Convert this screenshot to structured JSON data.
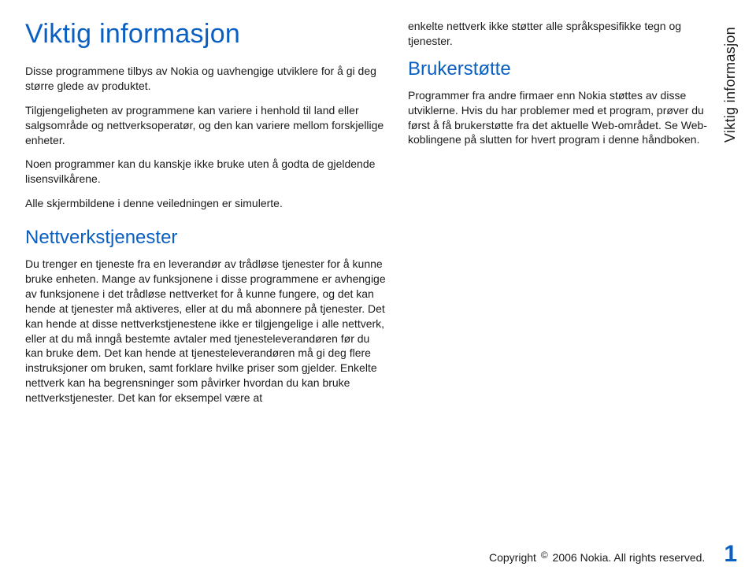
{
  "title": "Viktig informasjon",
  "sidebar_label": "Viktig informasjon",
  "left": {
    "p1": "Disse programmene tilbys av Nokia og uavhengige utviklere for å gi deg større glede av produktet.",
    "p2": "Tilgjengeligheten av programmene kan variere i henhold til land eller salgsområde og nettverksoperatør, og den kan variere mellom forskjellige enheter.",
    "p3": "Noen programmer kan du kanskje ikke bruke uten å godta de gjeldende lisensvilkårene.",
    "p4": "Alle skjermbildene i denne veiledningen er simulerte.",
    "h2": "Nettverkstjenester",
    "p5": "Du trenger en tjeneste fra en leverandør av trådløse tjenester for å kunne bruke enheten. Mange av funksjonene i disse programmene er avhengige av funksjonene i det trådløse nettverket for å kunne fungere, og det kan hende at tjenester må aktiveres, eller at du må abonnere på tjenester. Det kan hende at disse nettverkstjenestene ikke er tilgjengelige i alle nettverk, eller at du må inngå bestemte avtaler med tjenesteleverandøren før du kan bruke dem. Det kan hende at tjenesteleverandøren må gi deg flere instruksjoner om bruken, samt forklare hvilke priser som gjelder. Enkelte nettverk kan ha begrensninger som påvirker hvordan du kan bruke nettverkstjenester. Det kan for eksempel være at"
  },
  "right": {
    "p1": "enkelte nettverk ikke støtter alle språkspesifikke tegn og tjenester.",
    "h2": "Brukerstøtte",
    "p2": "Programmer fra andre firmaer enn Nokia støttes av disse utviklerne. Hvis du har problemer med et program, prøver du først å få brukerstøtte fra det aktuelle Web-området. Se Web-koblingene på slutten for hvert program i denne håndboken."
  },
  "footer": {
    "copyright_pre": "Copyright ",
    "copyright_post": " 2006 Nokia. All rights reserved.",
    "page": "1"
  }
}
